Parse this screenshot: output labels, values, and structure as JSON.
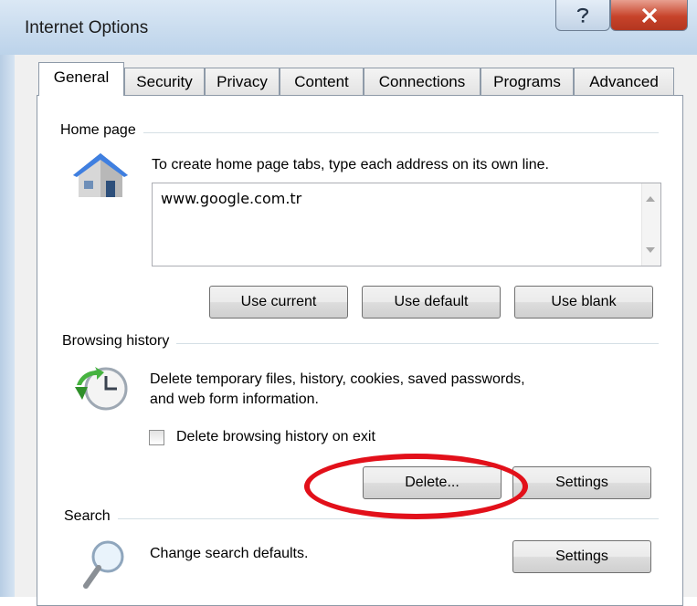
{
  "window": {
    "title": "Internet Options",
    "help_icon": "question-mark-icon",
    "close_icon": "close-x-icon"
  },
  "tabs": [
    {
      "label": "General",
      "active": true
    },
    {
      "label": "Security"
    },
    {
      "label": "Privacy"
    },
    {
      "label": "Content"
    },
    {
      "label": "Connections"
    },
    {
      "label": "Programs"
    },
    {
      "label": "Advanced"
    }
  ],
  "home_page": {
    "group_label": "Home page",
    "icon": "house-icon",
    "instruction": "To create home page tabs, type each address on its own line.",
    "address_value": "www.google.com.tr",
    "buttons": {
      "use_current": "Use current",
      "use_default": "Use default",
      "use_blank": "Use blank"
    }
  },
  "browsing_history": {
    "group_label": "Browsing history",
    "icon": "history-clock-icon",
    "description_line1": "Delete temporary files, history, cookies, saved passwords,",
    "description_line2": "and web form information.",
    "checkbox_label": "Delete browsing history on exit",
    "checkbox_checked": false,
    "buttons": {
      "delete": "Delete...",
      "settings": "Settings"
    }
  },
  "search": {
    "group_label": "Search",
    "icon": "magnifier-icon",
    "description": "Change search defaults.",
    "settings_button": "Settings"
  },
  "annotation": {
    "highlight_color": "#e2101a",
    "highlight_target": "Delete..."
  }
}
